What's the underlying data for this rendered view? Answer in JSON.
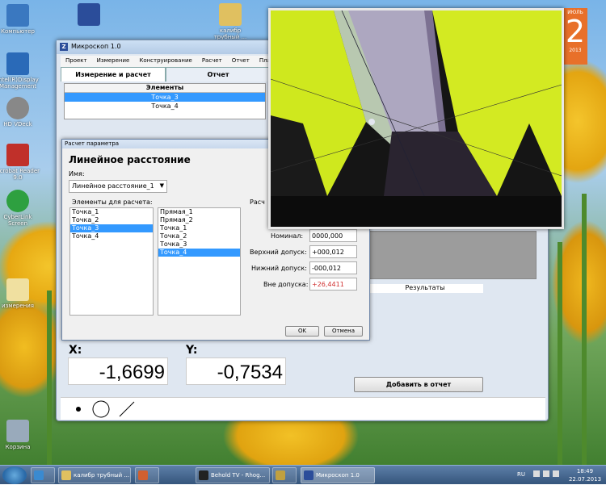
{
  "desktop": {
    "icons": [
      {
        "label": "Компьютер",
        "color": "#3a78c0"
      },
      {
        "label": "Intel(R)Display Management",
        "color": "#2a6ab8"
      },
      {
        "label": "HD VDeck",
        "color": "#888888"
      },
      {
        "label": "Acrobat Reader 9.0",
        "color": "#c0302a"
      },
      {
        "label": "CyberLink Screen",
        "color": "#2ea040"
      },
      {
        "label": "измерения",
        "color": "#f0e0a0"
      },
      {
        "label": "Корзина",
        "color": "#9ab"
      }
    ],
    "top_icons": [
      {
        "label": "",
        "color": "#2b4d9a"
      },
      {
        "label": "калибр трубный ...",
        "color": "#e0c060"
      }
    ],
    "calendar": {
      "month": "ИЮЛЬ",
      "day": "2",
      "year": "2013"
    }
  },
  "window": {
    "title": "Микроскоп 1.0",
    "menu": [
      "Проект",
      "Измерение",
      "Конструирование",
      "Расчет",
      "Отчет",
      "Плата"
    ],
    "tabs": [
      "Измерение и расчет",
      "Отчет"
    ],
    "elements": {
      "header": "Элементы",
      "rows": [
        "Точка_3",
        "Точка_4"
      ],
      "selected": 0
    },
    "results_button": "Результаты",
    "x_label": "X:",
    "x_value": "-1,6699",
    "y_label": "Y:",
    "y_value": "-0,7534",
    "add_button": "Добавить в отчет",
    "tools": [
      "point-tool",
      "circle-tool",
      "line-tool"
    ]
  },
  "dialog": {
    "title": "Расчет параметра",
    "heading": "Линейное расстояние",
    "name_label": "Имя:",
    "name_value": "Линейное расстояние_1",
    "calc_elements_label": "Элементы для расчета:",
    "calc_label": "Расч",
    "list1": [
      "Точка_1",
      "Точка_2",
      "Точка_3",
      "Точка_4"
    ],
    "list1_selected": 2,
    "list2": [
      "Прямая_1",
      "Прямая_2",
      "Точка_1",
      "Точка_2",
      "Точка_3",
      "Точка_4"
    ],
    "list2_selected": 5,
    "nominal_label": "Номинал:",
    "nominal_value": "0000,000",
    "upper_label": "Верхний допуск:",
    "upper_value": "+000,012",
    "lower_label": "Нижний допуск:",
    "lower_value": "-000,012",
    "out_label": "Вне допуска:",
    "out_value": "+26,4411",
    "ok": "OK",
    "cancel": "Отмена"
  },
  "taskbar": {
    "items": [
      {
        "label": "",
        "color": "#3a8ad0",
        "active": false
      },
      {
        "label": "калибр трубный ...",
        "color": "#e0c060",
        "active": false
      },
      {
        "label": "",
        "color": "#d06030",
        "active": false
      },
      {
        "label": "Behold TV - Rhog...",
        "color": "#222",
        "active": false
      },
      {
        "label": "",
        "color": "#c0a040",
        "active": false
      },
      {
        "label": "Микроскоп 1.0",
        "color": "#2b4d9a",
        "active": true
      }
    ],
    "lang": "RU",
    "time": "18:49",
    "date": "22.07.2013"
  },
  "colors": {
    "accent": "#3399ff",
    "error": "#d03030",
    "micro_yellow": "#d8f020"
  }
}
